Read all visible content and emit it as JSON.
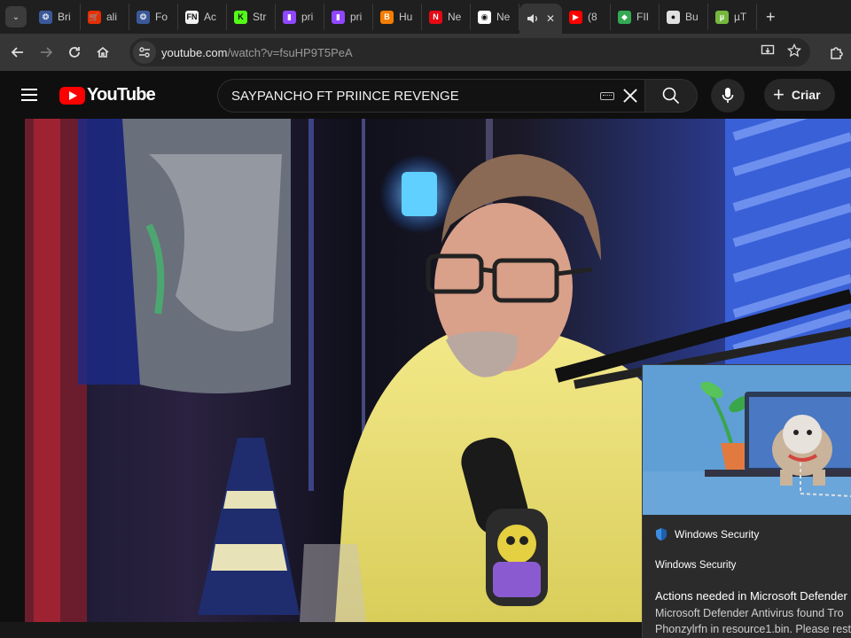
{
  "browser": {
    "tabs": [
      {
        "label": "Bri",
        "icon": "globe-icon",
        "color": "#3b5998"
      },
      {
        "label": "ali",
        "icon": "cart-icon",
        "color": "#e62e04"
      },
      {
        "label": "Fo",
        "icon": "globe-icon",
        "color": "#3b5998"
      },
      {
        "label": "Ac",
        "icon": "fn-icon",
        "color": "#f2f2f2"
      },
      {
        "label": "Str",
        "icon": "kick-icon",
        "color": "#53fc18"
      },
      {
        "label": "pri",
        "icon": "twitch-icon",
        "color": "#9146ff"
      },
      {
        "label": "pri",
        "icon": "twitch-icon",
        "color": "#9146ff"
      },
      {
        "label": "Hu",
        "icon": "blogger-icon",
        "color": "#f57d00"
      },
      {
        "label": "Ne",
        "icon": "netflix-icon",
        "color": "#e50914"
      },
      {
        "label": "Ne",
        "icon": "chrome-icon",
        "color": "#ffffff"
      }
    ],
    "active_tab": {
      "icon": "speaker-icon",
      "close": "✕"
    },
    "tabs_after": [
      {
        "label": "(8",
        "icon": "youtube-icon",
        "color": "#ff0000"
      },
      {
        "label": "FII",
        "icon": "shield-icon",
        "color": "#34a853"
      },
      {
        "label": "Bu",
        "icon": "multicolor-icon",
        "color": "#e0e0e0"
      },
      {
        "label": "µT",
        "icon": "utorrent-icon",
        "color": "#76b83f"
      }
    ],
    "new_tab": "+",
    "address": {
      "domain": "youtube.com",
      "path": "/watch?v=fsuHP9T5PeA"
    }
  },
  "youtube": {
    "logo_text": "YouTube",
    "search_query": "SAYPANCHO FT PRIINCE REVENGE",
    "create_label": "Criar"
  },
  "toast": {
    "app_name": "Windows Security",
    "title": "Windows Security",
    "heading": "Actions needed in Microsoft Defender",
    "body_line1": "Microsoft Defender Antivirus found Tro",
    "body_line2": "Phonzylrfn in resource1.bin. Please rest"
  },
  "colors": {
    "yt_red": "#ff0000",
    "toast_hero": "#5f9fd6",
    "toast_bg": "#2b2b2b"
  }
}
